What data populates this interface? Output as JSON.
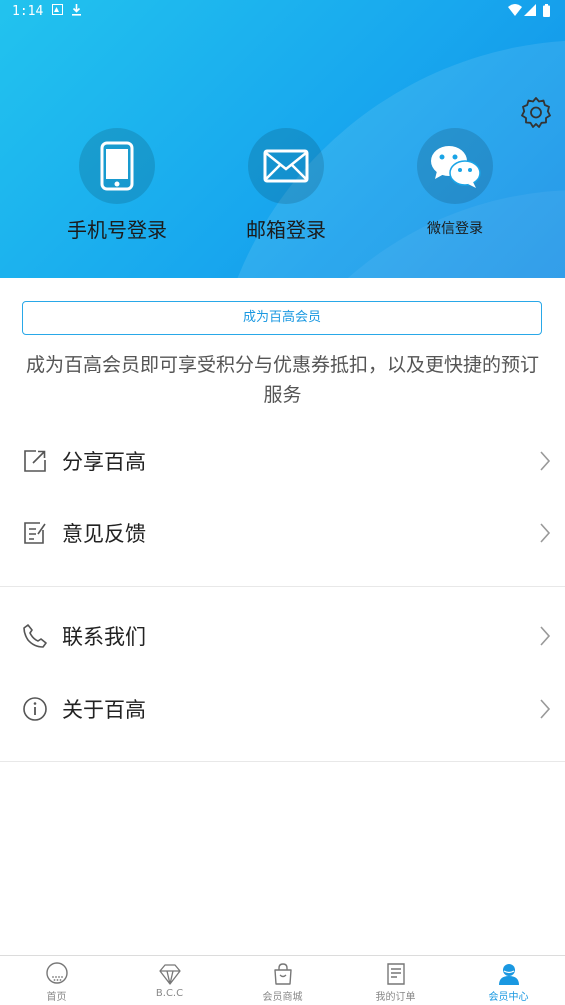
{
  "status_bar": {
    "time": "1:14"
  },
  "header": {
    "login_options": [
      {
        "label": "手机号登录",
        "icon": "phone-icon"
      },
      {
        "label": "邮箱登录",
        "icon": "mail-icon"
      },
      {
        "label": "微信登录",
        "icon": "wechat-icon"
      }
    ],
    "settings_icon": "gear-icon"
  },
  "member": {
    "button_label": "成为百高会员",
    "description": "成为百高会员即可享受积分与优惠券抵扣，以及更快捷的预订服务"
  },
  "menu": {
    "group1": [
      {
        "label": "分享百高",
        "icon": "share-icon"
      },
      {
        "label": "意见反馈",
        "icon": "feedback-icon"
      }
    ],
    "group2": [
      {
        "label": "联系我们",
        "icon": "phone-call-icon"
      },
      {
        "label": "关于百高",
        "icon": "info-icon"
      }
    ]
  },
  "tabbar": {
    "items": [
      {
        "label": "首页",
        "icon": "golf-ball-icon"
      },
      {
        "label": "B.C.C",
        "icon": "diamond-icon"
      },
      {
        "label": "会员商城",
        "icon": "shopping-bag-icon"
      },
      {
        "label": "我的订单",
        "icon": "order-list-icon"
      },
      {
        "label": "会员中心",
        "icon": "member-icon",
        "active": true
      }
    ]
  },
  "colors": {
    "accent": "#1a98e1",
    "header_start": "#22c3ee",
    "header_end": "#0f8de6"
  }
}
